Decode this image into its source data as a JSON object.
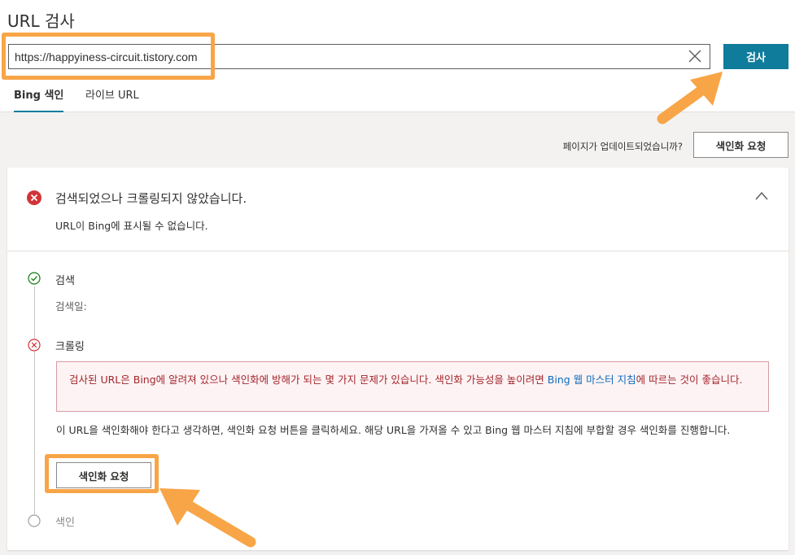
{
  "header": {
    "title": "URL 검사",
    "url_value": "https://happyiness-circuit.tistory.com",
    "search_button": "검사"
  },
  "tabs": [
    {
      "label": "Bing 색인",
      "active": true
    },
    {
      "label": "라이브 URL",
      "active": false
    }
  ],
  "update_prompt": {
    "question": "페이지가 업데이트되었습니까?",
    "button": "색인화 요청"
  },
  "status": {
    "title": "검색되었으나 크롤링되지 않았습니다.",
    "subtitle": "URL이 Bing에 표시될 수 없습니다."
  },
  "steps": [
    {
      "label": "검색",
      "detail": "검색일:",
      "state": "done"
    },
    {
      "label": "크롤링",
      "state": "error"
    },
    {
      "label": "색인",
      "state": "pending"
    }
  ],
  "alert": {
    "text_1": "검사된 URL은 Bing에 알려져 있으나 색인화에 방해가 되는 몇 가지 문제가 있습니다. 색인화 가능성을 높이려면 ",
    "link": "Bing 웹 마스터 지침",
    "text_2": "에 따르는 것이 좋습니다."
  },
  "info": {
    "text": "이 URL을 색인화해야 한다고 생각하면, 색인화 요청 버튼을 클릭하세요. 해당 URL을 가져올 수 있고 Bing 웹 마스터 지침에 부합할 경우 색인화를 진행합니다.",
    "button": "색인화 요청"
  },
  "colors": {
    "accent": "#0f7c9b",
    "error": "#d13438",
    "success": "#107c10",
    "highlight": "#f8a547"
  }
}
